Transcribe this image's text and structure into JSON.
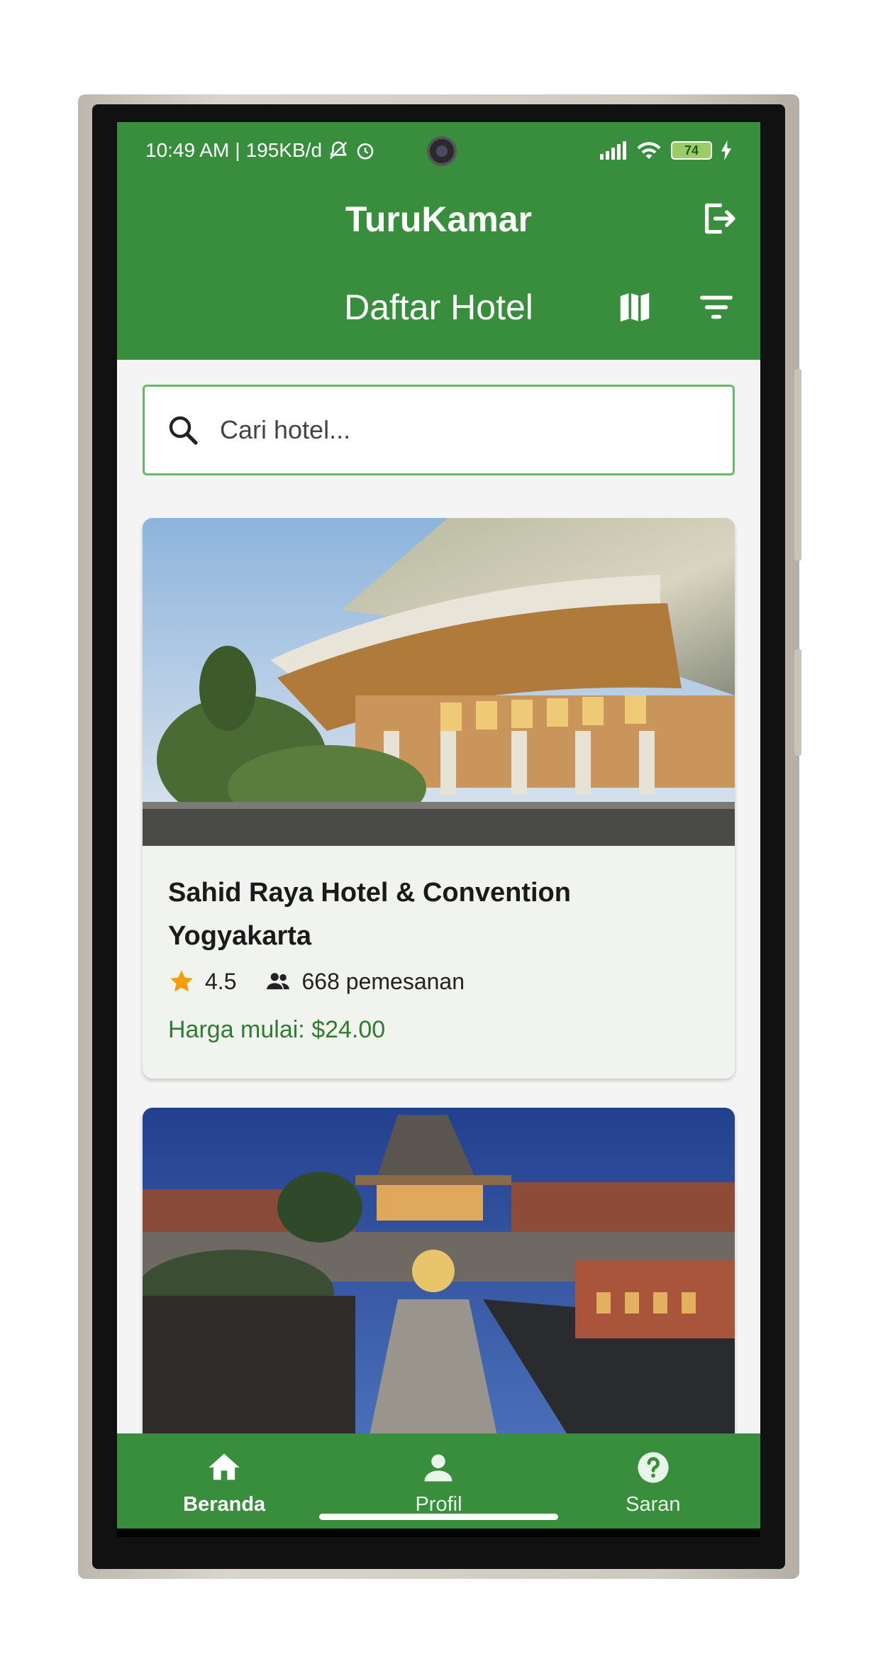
{
  "status_bar": {
    "time": "10:49 AM",
    "data_speed": "195KB/d",
    "battery_level": "74",
    "icons": [
      "mute-bell-icon",
      "alarm-icon",
      "signal-icon",
      "wifi-icon",
      "battery-icon",
      "charging-icon"
    ]
  },
  "app": {
    "title": "TuruKamar",
    "section_title": "Daftar Hotel",
    "accent_color": "#388e3c",
    "price_color": "#2e7d32"
  },
  "search": {
    "placeholder": "Cari hotel...",
    "value": ""
  },
  "hotels": [
    {
      "name": "Sahid Raya Hotel & Convention Yogyakarta",
      "rating": "4.5",
      "bookings": "668 pemesanan",
      "price": "Harga mulai: $24.00"
    },
    {
      "name": "",
      "rating": "",
      "bookings": "",
      "price": ""
    }
  ],
  "bottom_nav": {
    "items": [
      {
        "label": "Beranda",
        "icon": "home-icon",
        "active": true
      },
      {
        "label": "Profil",
        "icon": "person-icon",
        "active": false
      },
      {
        "label": "Saran",
        "icon": "help-icon",
        "active": false
      }
    ]
  }
}
